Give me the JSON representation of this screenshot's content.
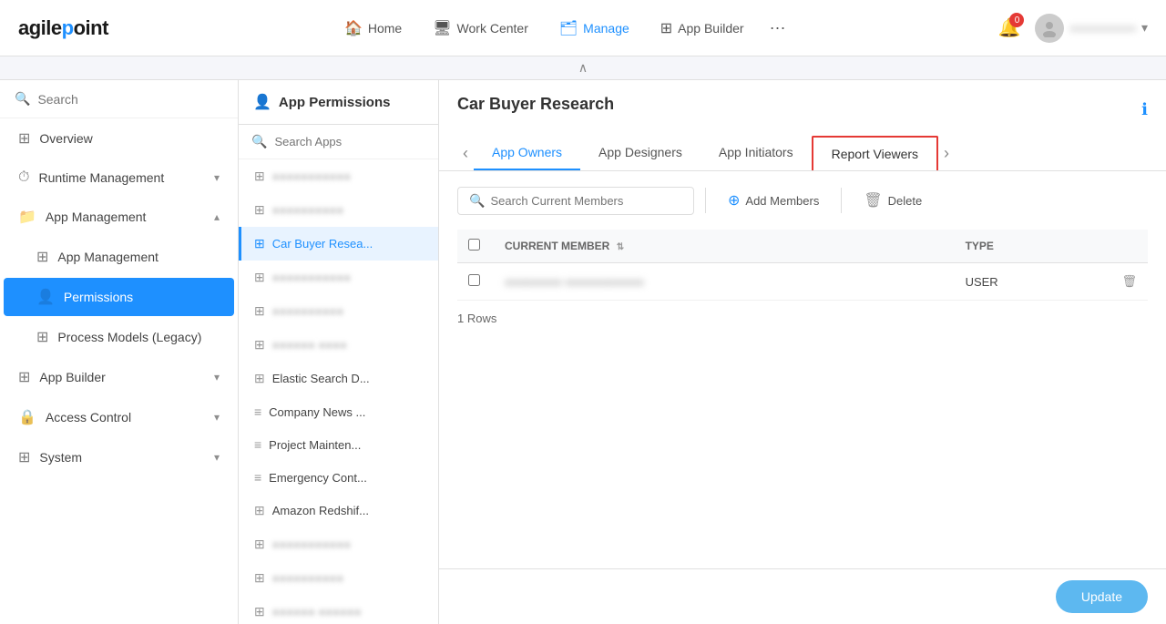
{
  "logo": {
    "text": "agilepoint",
    "dot_char": "●"
  },
  "nav": {
    "items": [
      {
        "id": "home",
        "label": "Home",
        "icon": "🏠",
        "active": false
      },
      {
        "id": "workcenter",
        "label": "Work Center",
        "icon": "🖥",
        "active": false
      },
      {
        "id": "manage",
        "label": "Manage",
        "icon": "🗂",
        "active": true
      },
      {
        "id": "appbuilder",
        "label": "App Builder",
        "icon": "⊞",
        "active": false
      }
    ],
    "dots": "···",
    "notification_count": "0",
    "user_name": "●●●●●●●●●●"
  },
  "sidebar": {
    "search_placeholder": "Search",
    "items": [
      {
        "id": "overview",
        "label": "Overview",
        "icon": "⊞",
        "active": false,
        "expandable": false
      },
      {
        "id": "runtime",
        "label": "Runtime Management",
        "icon": "⏱",
        "active": false,
        "expandable": true
      },
      {
        "id": "appmanagement",
        "label": "App Management",
        "icon": "📁",
        "active": false,
        "expandable": true,
        "expanded": true
      },
      {
        "id": "appmanagement-sub",
        "label": "App Management",
        "icon": "⊞",
        "active": false,
        "sub": true
      },
      {
        "id": "permissions",
        "label": "Permissions",
        "icon": "👤",
        "active": true,
        "sub": true
      },
      {
        "id": "processmodels",
        "label": "Process Models (Legacy)",
        "icon": "⊞",
        "active": false,
        "sub": true
      },
      {
        "id": "appbuilder",
        "label": "App Builder",
        "icon": "⊞",
        "active": false,
        "expandable": true
      },
      {
        "id": "accesscontrol",
        "label": "Access Control",
        "icon": "🔒",
        "active": false,
        "expandable": true
      },
      {
        "id": "system",
        "label": "System",
        "icon": "⊞",
        "active": false,
        "expandable": true
      }
    ]
  },
  "middle_panel": {
    "icon": "👤",
    "title": "App Permissions",
    "search_placeholder": "Search Apps",
    "apps": [
      {
        "id": "app1",
        "name": "●●●●●●●●●●●",
        "active": false,
        "blurred": true,
        "icon": "⊞"
      },
      {
        "id": "app2",
        "name": "●●●●●●●●●●",
        "active": false,
        "blurred": true,
        "icon": "⊞"
      },
      {
        "id": "app3",
        "name": "Car Buyer Resea...",
        "active": true,
        "blurred": false,
        "icon": "⊞"
      },
      {
        "id": "app4",
        "name": "●●●●●●●●●●●",
        "active": false,
        "blurred": true,
        "icon": "⊞"
      },
      {
        "id": "app5",
        "name": "●●●●●●●●●●",
        "active": false,
        "blurred": true,
        "icon": "⊞"
      },
      {
        "id": "app6",
        "name": "●●●●●● ●●●●",
        "active": false,
        "blurred": true,
        "icon": "⊞"
      },
      {
        "id": "app7",
        "name": "Elastic Search D...",
        "active": false,
        "blurred": false,
        "icon": "⊞"
      },
      {
        "id": "app8",
        "name": "Company News ...",
        "active": false,
        "blurred": false,
        "icon": "≡"
      },
      {
        "id": "app9",
        "name": "Project Mainten...",
        "active": false,
        "blurred": false,
        "icon": "≡"
      },
      {
        "id": "app10",
        "name": "Emergency Cont...",
        "active": false,
        "blurred": false,
        "icon": "≡"
      },
      {
        "id": "app11",
        "name": "Amazon Redshif...",
        "active": false,
        "blurred": false,
        "icon": "⊞"
      },
      {
        "id": "app12",
        "name": "●●●●●●●●●●●",
        "active": false,
        "blurred": true,
        "icon": "⊞"
      },
      {
        "id": "app13",
        "name": "●●●●●●●●●●",
        "active": false,
        "blurred": true,
        "icon": "⊞"
      },
      {
        "id": "app14",
        "name": "●●●●●● ●●●●●●",
        "active": false,
        "blurred": true,
        "icon": "⊞"
      }
    ]
  },
  "right_panel": {
    "title": "Car Buyer Research",
    "tabs": [
      {
        "id": "owners",
        "label": "App Owners",
        "active": true,
        "highlighted": false
      },
      {
        "id": "designers",
        "label": "App Designers",
        "active": false,
        "highlighted": false
      },
      {
        "id": "initiators",
        "label": "App Initiators",
        "active": false,
        "highlighted": false
      },
      {
        "id": "viewers",
        "label": "Report Viewers",
        "active": false,
        "highlighted": true
      }
    ],
    "toolbar": {
      "search_placeholder": "Search Current Members",
      "add_label": "Add Members",
      "delete_label": "Delete"
    },
    "table": {
      "col_member": "CURRENT MEMBER",
      "col_type": "TYPE",
      "rows": [
        {
          "member": "●●●●●●●● ●●●●●●●●●●●",
          "type": "USER",
          "blurred": true
        }
      ],
      "row_count": "1 Rows"
    },
    "update_label": "Update",
    "collapse_char": "∧"
  }
}
